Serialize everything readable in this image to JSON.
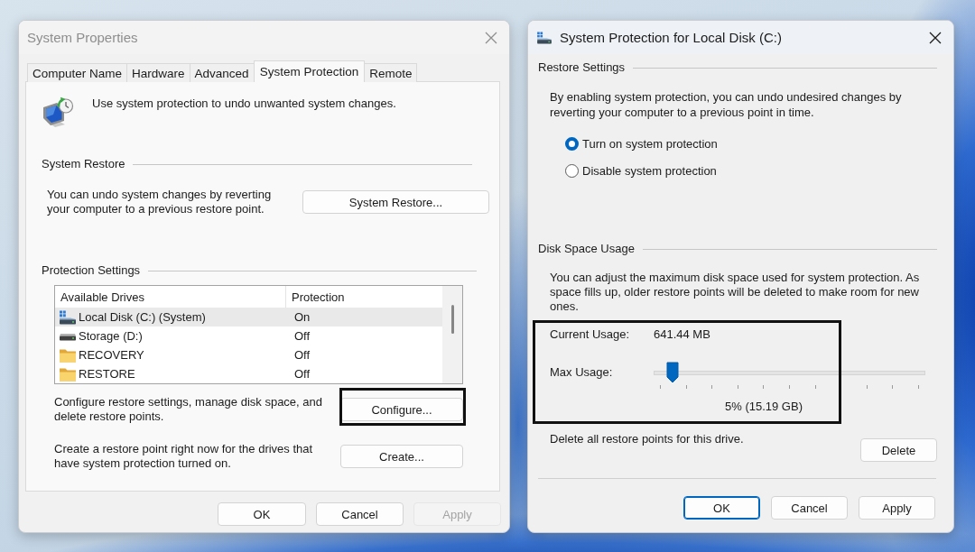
{
  "system_properties": {
    "title": "System Properties",
    "active": false,
    "tabs": [
      {
        "label": "Computer Name",
        "selected": false
      },
      {
        "label": "Hardware",
        "selected": false
      },
      {
        "label": "Advanced",
        "selected": false
      },
      {
        "label": "System Protection",
        "selected": true
      },
      {
        "label": "Remote",
        "selected": false
      }
    ],
    "intro": "Use system protection to undo unwanted system changes.",
    "system_restore": {
      "heading": "System Restore",
      "text": "You can undo system changes by reverting your computer to a previous restore point.",
      "button": "System Restore..."
    },
    "protection_settings": {
      "heading": "Protection Settings",
      "table": {
        "columns": [
          "Available Drives",
          "Protection"
        ],
        "rows": [
          {
            "kind": "system-drive",
            "drive": "Local Disk (C:) (System)",
            "protection": "On",
            "selected": true
          },
          {
            "kind": "drive",
            "drive": "Storage (D:)",
            "protection": "Off",
            "selected": false
          },
          {
            "kind": "folder",
            "drive": "RECOVERY",
            "protection": "Off",
            "selected": false
          },
          {
            "kind": "folder",
            "drive": "RESTORE",
            "protection": "Off",
            "selected": false
          }
        ]
      },
      "actions": [
        {
          "text": "Configure restore settings, manage disk space, and delete restore points.",
          "button": "Configure...",
          "highlighted": true
        },
        {
          "text": "Create a restore point right now for the drives that have system protection turned on.",
          "button": "Create...",
          "highlighted": false
        }
      ]
    },
    "buttons": [
      {
        "label": "OK",
        "disabled": false,
        "default": false
      },
      {
        "label": "Cancel",
        "disabled": false,
        "default": false
      },
      {
        "label": "Apply",
        "disabled": true,
        "default": false
      }
    ]
  },
  "protection_dialog": {
    "title": "System Protection for Local Disk (C:)",
    "active": true,
    "restore_settings": {
      "heading": "Restore Settings",
      "text": "By enabling system protection, you can undo undesired changes by reverting your computer to a previous point in time.",
      "options": [
        {
          "label": "Turn on system protection",
          "selected": true
        },
        {
          "label": "Disable system protection",
          "selected": false
        }
      ]
    },
    "disk_space_usage": {
      "heading": "Disk Space Usage",
      "text": "You can adjust the maximum disk space used for system protection. As space fills up, older restore points will be deleted to make room for new ones.",
      "highlighted": true,
      "current_usage_label": "Current Usage:",
      "current_usage": "641.44 MB",
      "max_usage_label": "Max Usage:",
      "max_usage_slider": {
        "level": 0.05
      },
      "max_usage_reading": "5% (15.19 GB)",
      "delete_text": "Delete all restore points for this drive.",
      "delete_button": "Delete"
    },
    "buttons": [
      {
        "label": "OK",
        "disabled": false,
        "default": true
      },
      {
        "label": "Cancel",
        "disabled": false,
        "default": false
      },
      {
        "label": "Apply",
        "disabled": false,
        "default": false
      }
    ]
  }
}
